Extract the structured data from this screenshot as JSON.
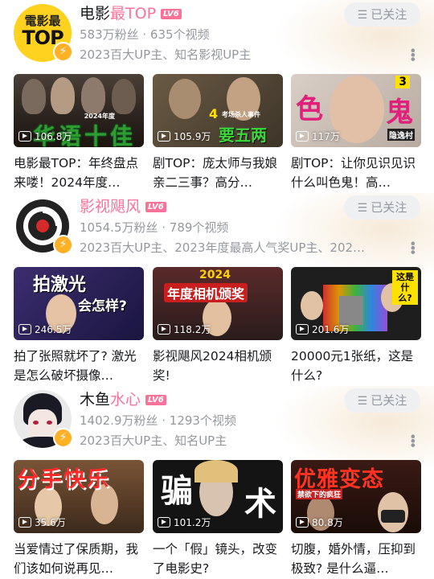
{
  "sections": [
    {
      "avatar_text_top": "電影最",
      "avatar_text_bottom": "TOP",
      "name_plain": "电影",
      "name_pink": "最TOP",
      "level": "LV6",
      "stats": "583万粉丝 · 635个视频",
      "tags": "2023百大UP主、知名影视UP主",
      "follow": "已关注",
      "videos": [
        {
          "views": "106.8万",
          "title": "电影最TOP：年终盘点来喽！2024年度…",
          "overlay_big": "华语十佳",
          "overlay_small": "2024年度"
        },
        {
          "views": "105.9万",
          "title": "剧TOP：庞太师与我娘亲二三事？高分…",
          "overlay_big": "要五两",
          "overlay_small": "考场杀人事件",
          "overlay_num": "4"
        },
        {
          "views": "117万",
          "title": "剧TOP：让你见识见识什么叫色鬼！高…",
          "overlay_a": "色",
          "overlay_b": "鬼",
          "overlay_num": "3",
          "overlay_small": "隐逸村"
        }
      ]
    },
    {
      "name_plain": "",
      "name_pink": "影视飓风",
      "level": "LV6",
      "stats": "1054.5万粉丝 · 789个视频",
      "tags": "2023百大UP主、2023年度最高人气奖UP主、202…",
      "follow": "已关注",
      "videos": [
        {
          "views": "246.5万",
          "title": "拍了张照就坏了? 激光是怎么破坏摄像…",
          "overlay_big": "拍激光",
          "overlay_small": "会怎样?"
        },
        {
          "views": "118.2万",
          "title": "影视飓风2024相机颁奖!",
          "overlay_big": "年度相机颁奖",
          "overlay_small": "2024"
        },
        {
          "views": "201.6万",
          "title": "20000元1张纸，这是什么?",
          "overlay_big": "这是什么?"
        }
      ]
    },
    {
      "name_plain": "木鱼",
      "name_pink": "水心",
      "level": "LV6",
      "stats": "1402.9万粉丝 · 1293个视频",
      "tags": "2023百大UP主、知名UP主",
      "follow": "已关注",
      "videos": [
        {
          "views": "35.6万",
          "title": "当爱情过了保质期，我们该如何说再见…",
          "overlay_big": "分手快乐"
        },
        {
          "views": "101.2万",
          "title": "一个「假」镜头，改变了电影史?",
          "overlay_a": "骗",
          "overlay_b": "术"
        },
        {
          "views": "80.8万",
          "title": "切腹，婚外情，压抑到极致? 是什么逼…",
          "overlay_big": "优雅变态",
          "overlay_small": "禁欲下的疯狂"
        }
      ]
    }
  ]
}
